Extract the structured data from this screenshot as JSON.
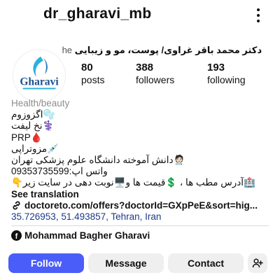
{
  "header": {
    "username": "dr_gharavi_mb",
    "more_icon": "more-vertical-icon"
  },
  "profile": {
    "full_name": "دکتر محمد باقر غراوی/ پوست، مو و زیبایی",
    "pronouns": "he",
    "avatar_logo_text": "Gharavi",
    "stats": {
      "posts": {
        "count": "80",
        "label": "posts"
      },
      "followers": {
        "count": "388",
        "label": "followers"
      },
      "following": {
        "count": "193",
        "label": "following"
      }
    }
  },
  "bio": {
    "category": "Health/beauty",
    "lines": [
      "🫧اگزوزوم",
      "⚕️نخ لیفت",
      "PRP🩸",
      "💉مزوتراپی",
      "🧑🏻‍⚕️دانش آموخته دانشگاه علوم پزشکی تهران",
      "واتس اپ:09353735599",
      "🏥آدرس مطب ها ، 💲قیمت ها و🖥️نوبت دهی در سایت زیر👇"
    ],
    "see_translation": "See translation",
    "link": "doctoreto.com/offers?doctorId=GXpPeE&sort=hig...",
    "location": "35.726953, 51.493857, Tehran, Iran"
  },
  "facebook": {
    "name": "Mohammad Bagher Gharavi"
  },
  "actions": {
    "follow": "Follow",
    "message": "Message",
    "contact": "Contact",
    "add_icon": "add-person-icon"
  },
  "colors": {
    "follow_button": "#4a5df9",
    "secondary_button": "#efefef",
    "location_text": "#1d3a8a",
    "category_text": "#8e8e8e"
  }
}
